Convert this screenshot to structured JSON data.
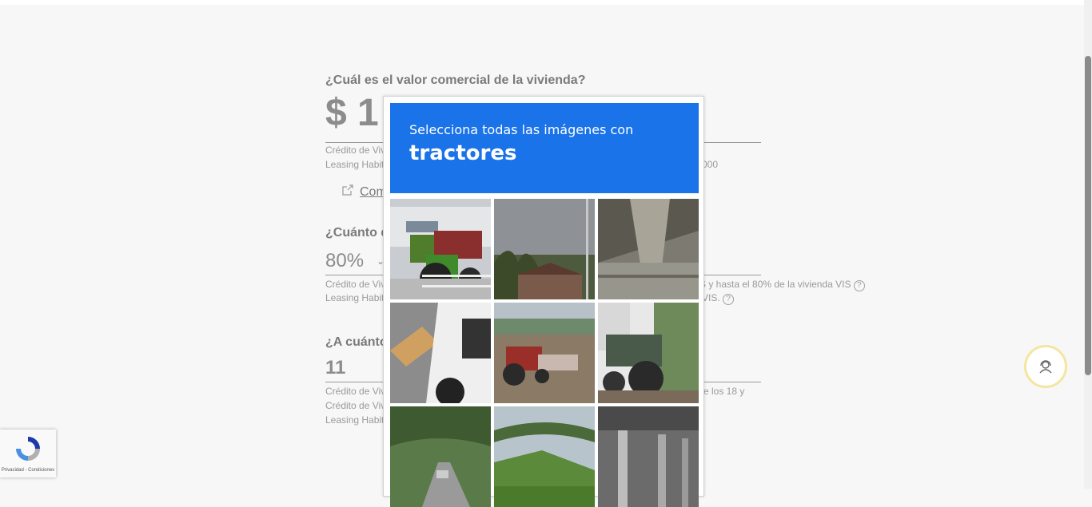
{
  "form": {
    "q1": "¿Cuál es el valor comercial de la vivienda?",
    "value_prefix": "$ 1",
    "note1a": "Crédito de Viv",
    "note1b": "Leasing Habit",
    "note1c": "000",
    "link_label": "Com",
    "q2": "¿Cuánto d",
    "pct": "80%",
    "note2a": "Crédito de Viv",
    "note2b": "Leasing Habit",
    "note2c": "S y hasta el 80% de la vivienda VIS",
    "note2d": "VIS.",
    "q3": "¿A cuánto",
    "years": "11",
    "note3a": "Crédito de Viv",
    "note3b": "Crédito de Viv",
    "note3c": "Leasing Habit",
    "note3d": "re los 18 y",
    "help": "?"
  },
  "captcha": {
    "instruction": "Selecciona todas las imágenes con",
    "target": "tractores",
    "tiles": [
      "tractor-green-warehouse",
      "sky-palms-house",
      "overpass-underside",
      "white-car",
      "red-tractor-field",
      "old-tractor-shed",
      "tree-lined-street",
      "green-bridge-hill",
      "overpass-pillars"
    ]
  },
  "recaptcha_badge": {
    "text": "Privacidad - Condiciones"
  },
  "colors": {
    "accent": "#1a73e8",
    "support_ring": "#f3e6a0"
  }
}
